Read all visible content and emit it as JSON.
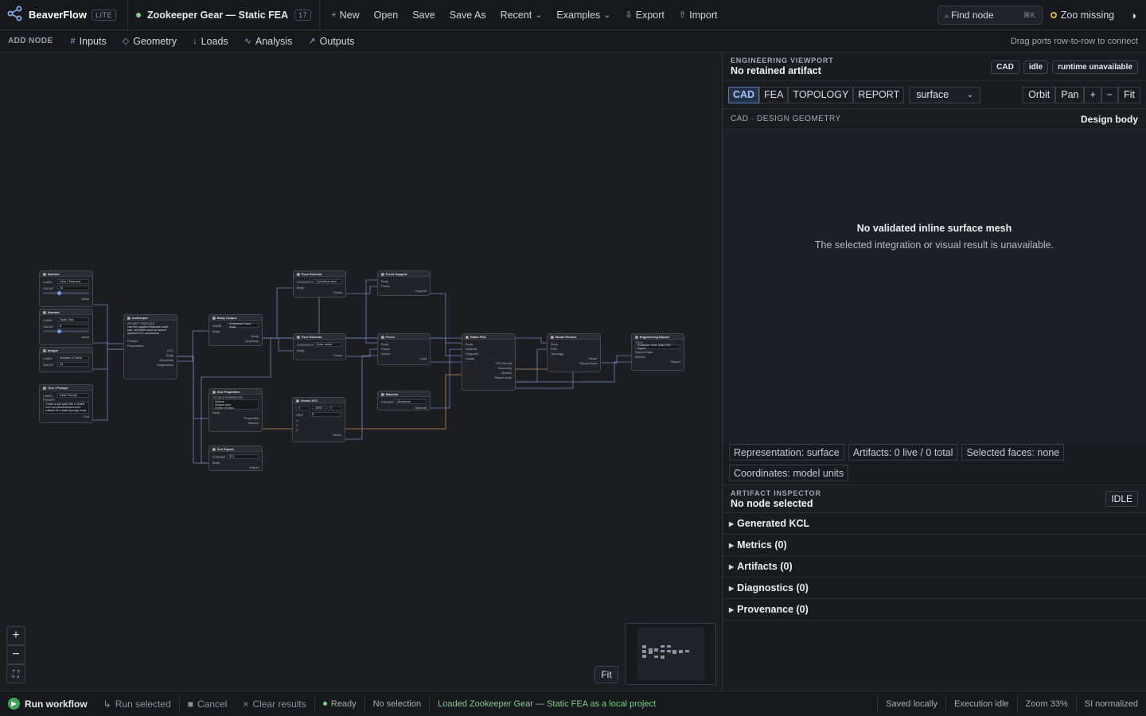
{
  "app": {
    "name": "BeaverFlow",
    "edition": "LITE"
  },
  "project": {
    "title": "Zookeeper Gear — Static FEA",
    "count": "17"
  },
  "menu": {
    "new": "New",
    "open": "Open",
    "save": "Save",
    "save_as": "Save As",
    "recent": "Recent",
    "examples": "Examples",
    "export": "Export",
    "import": "Import"
  },
  "search": {
    "label": "Find node",
    "shortcut": "⌘K"
  },
  "zoo_status": "Zoo missing",
  "toolbar": {
    "label": "ADD NODE",
    "cats": [
      "Inputs",
      "Geometry",
      "Loads",
      "Analysis",
      "Outputs"
    ],
    "hint": "Drag ports row-to-row to connect"
  },
  "canvas": {
    "fit": "Fit"
  },
  "nodes": {
    "number1": {
      "title": "Number",
      "label_key": "LABEL",
      "label": "Gear Thickness",
      "value_key": "VALUE",
      "value": "12",
      "unit_key": "UNIT",
      "unit": "mm",
      "out": "Value"
    },
    "number2": {
      "title": "Number",
      "label_key": "LABEL",
      "label": "Tooth Size",
      "value_key": "VALUE",
      "value": "8",
      "unit_key": "UNIT",
      "unit": "mm",
      "out": "Value"
    },
    "integer": {
      "title": "Integer",
      "label_key": "LABEL",
      "label": "Number of Teeth",
      "value_key": "VALUE",
      "value": "24",
      "out": "Value"
    },
    "text": {
      "title": "Text / Prompt",
      "label_key": "LABEL",
      "label": "Gear Prompt",
      "prompt_key": "PROMPT",
      "prompt": "Create a spur gear with a central bore and parameterised teeth suitable for a static topology study.",
      "out": "Text"
    },
    "zookeeper": {
      "title": "Zookeeper",
      "desc_key": "PROMPT TEMPLATE",
      "desc": "Use the supplied thickness, tooth size, and teeth count as named symbolic KCL parameters.",
      "in1": "Prompt",
      "in2": "Parameters",
      "out1": "KCL",
      "out2": "Body",
      "out3": "Geometry",
      "out4": "Diagnostics"
    },
    "body_output": {
      "title": "Body Output",
      "name_key": "NAME",
      "name": "Zookeeper Spur Gear",
      "in": "Body",
      "out1": "Body",
      "out2": "Geometry"
    },
    "zoo_properties": {
      "title": "Zoo Properties",
      "key": "TO FACE PROPERTIES",
      "opt1": "Volume",
      "opt2": "Surface area",
      "opt3": "Center of mass",
      "in": "Body",
      "out1": "Properties",
      "out2": "Metrics"
    },
    "zoo_export": {
      "title": "Zoo Export",
      "format_key": "FORMAT",
      "format": "STL",
      "in": "Body",
      "out": "Export"
    },
    "face_selector1": {
      "title": "Face Selector",
      "strategy_key": "STRATEGY",
      "strategy": "Cylindrical bore",
      "in": "Body",
      "out": "Faces"
    },
    "face_selector2": {
      "title": "Face Selector",
      "strategy_key": "STRATEGY",
      "strategy": "Outer radial",
      "in": "Body",
      "out": "Faces"
    },
    "vector": {
      "title": "Vector XYZ",
      "x": "0",
      "y": "-1500",
      "z": "0",
      "unit_key": "UNIT",
      "unit": "N",
      "out": "Vector"
    },
    "fixed_support": {
      "title": "Fixed Support",
      "in1": "Body",
      "in2": "Faces",
      "out": "Support"
    },
    "force": {
      "title": "Force",
      "in1": "Body",
      "in2": "Faces",
      "in3": "Vector",
      "out": "Load"
    },
    "material": {
      "title": "Material",
      "preset_key": "PRESET",
      "preset": "Aluminum",
      "out": "Material"
    },
    "static_fea": {
      "title": "Static FEA",
      "in1": "Body",
      "in2": "Material",
      "in3": "Supports",
      "in4": "Loads",
      "out1": "FEA Result",
      "out2": "Geometry",
      "out3": "Metrics",
      "out4": "Report Data"
    },
    "model_review": {
      "title": "Model Review",
      "in1": "Body",
      "in2": "FEA",
      "in3": "Topology",
      "out1": "Visual",
      "out2": "Report Data"
    },
    "eng_report": {
      "title": "Engineering Report",
      "title_key": "TITLE",
      "title_val": "Zookeeper Gear Static FEA Report",
      "in1": "Report Data",
      "in2": "Metrics",
      "out": "Report"
    }
  },
  "viewport": {
    "section": "ENGINEERING VIEWPORT",
    "subtitle": "No retained artifact",
    "pills": [
      "CAD",
      "idle",
      "runtime unavailable"
    ],
    "tabs": [
      "CAD",
      "FEA",
      "TOPOLOGY",
      "REPORT"
    ],
    "mode": "surface",
    "view_buttons": [
      "Orbit",
      "Pan",
      "+",
      "−",
      "Fit"
    ],
    "design_label": "CAD · DESIGN GEOMETRY",
    "design_body": "Design body",
    "empty_title": "No validated inline surface mesh",
    "empty_sub": "The selected integration or visual result is unavailable.",
    "chips": [
      "Representation: surface",
      "Artifacts: 0 live / 0 total",
      "Selected faces: none",
      "Coordinates: model units"
    ]
  },
  "inspector": {
    "section": "ARTIFACT INSPECTOR",
    "subtitle": "No node selected",
    "state": "IDLE",
    "accordions": [
      "Generated KCL",
      "Metrics (0)",
      "Artifacts (0)",
      "Diagnostics (0)",
      "Provenance (0)"
    ]
  },
  "status": {
    "run": "Run workflow",
    "run_selected": "Run selected",
    "cancel": "Cancel",
    "clear": "Clear results",
    "ready": "Ready",
    "selection": "No selection",
    "message": "Loaded Zookeeper Gear — Static FEA as a local project",
    "saved": "Saved locally",
    "execution": "Execution idle",
    "zoom": "Zoom 33%",
    "units": "SI normalized"
  },
  "colors": {
    "accent": "#4f7fbf",
    "ok": "#3aa55a",
    "ready_dot": "#7fd08a",
    "message": "#7fd08a",
    "warn": "#d8a84c"
  }
}
